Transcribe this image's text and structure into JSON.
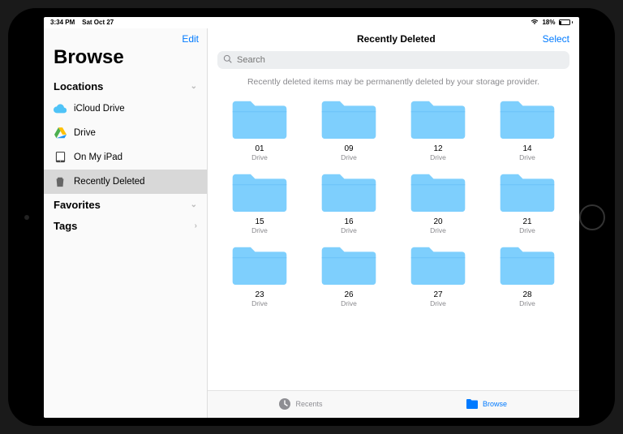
{
  "status": {
    "time": "3:34 PM",
    "date": "Sat Oct 27",
    "battery": "18%"
  },
  "sidebar": {
    "edit": "Edit",
    "title": "Browse",
    "locations_header": "Locations",
    "favorites_header": "Favorites",
    "tags_header": "Tags",
    "items": [
      {
        "label": "iCloud Drive"
      },
      {
        "label": "Drive"
      },
      {
        "label": "On My iPad"
      },
      {
        "label": "Recently Deleted"
      }
    ]
  },
  "main": {
    "title": "Recently Deleted",
    "select": "Select",
    "search_placeholder": "Search",
    "notice": "Recently deleted items may be permanently deleted by your storage provider."
  },
  "folders": [
    {
      "name": "01",
      "sub": "Drive"
    },
    {
      "name": "09",
      "sub": "Drive"
    },
    {
      "name": "12",
      "sub": "Drive"
    },
    {
      "name": "14",
      "sub": "Drive"
    },
    {
      "name": "15",
      "sub": "Drive"
    },
    {
      "name": "16",
      "sub": "Drive"
    },
    {
      "name": "20",
      "sub": "Drive"
    },
    {
      "name": "21",
      "sub": "Drive"
    },
    {
      "name": "23",
      "sub": "Drive"
    },
    {
      "name": "26",
      "sub": "Drive"
    },
    {
      "name": "27",
      "sub": "Drive"
    },
    {
      "name": "28",
      "sub": "Drive"
    }
  ],
  "tabs": {
    "recents": "Recents",
    "browse": "Browse"
  }
}
